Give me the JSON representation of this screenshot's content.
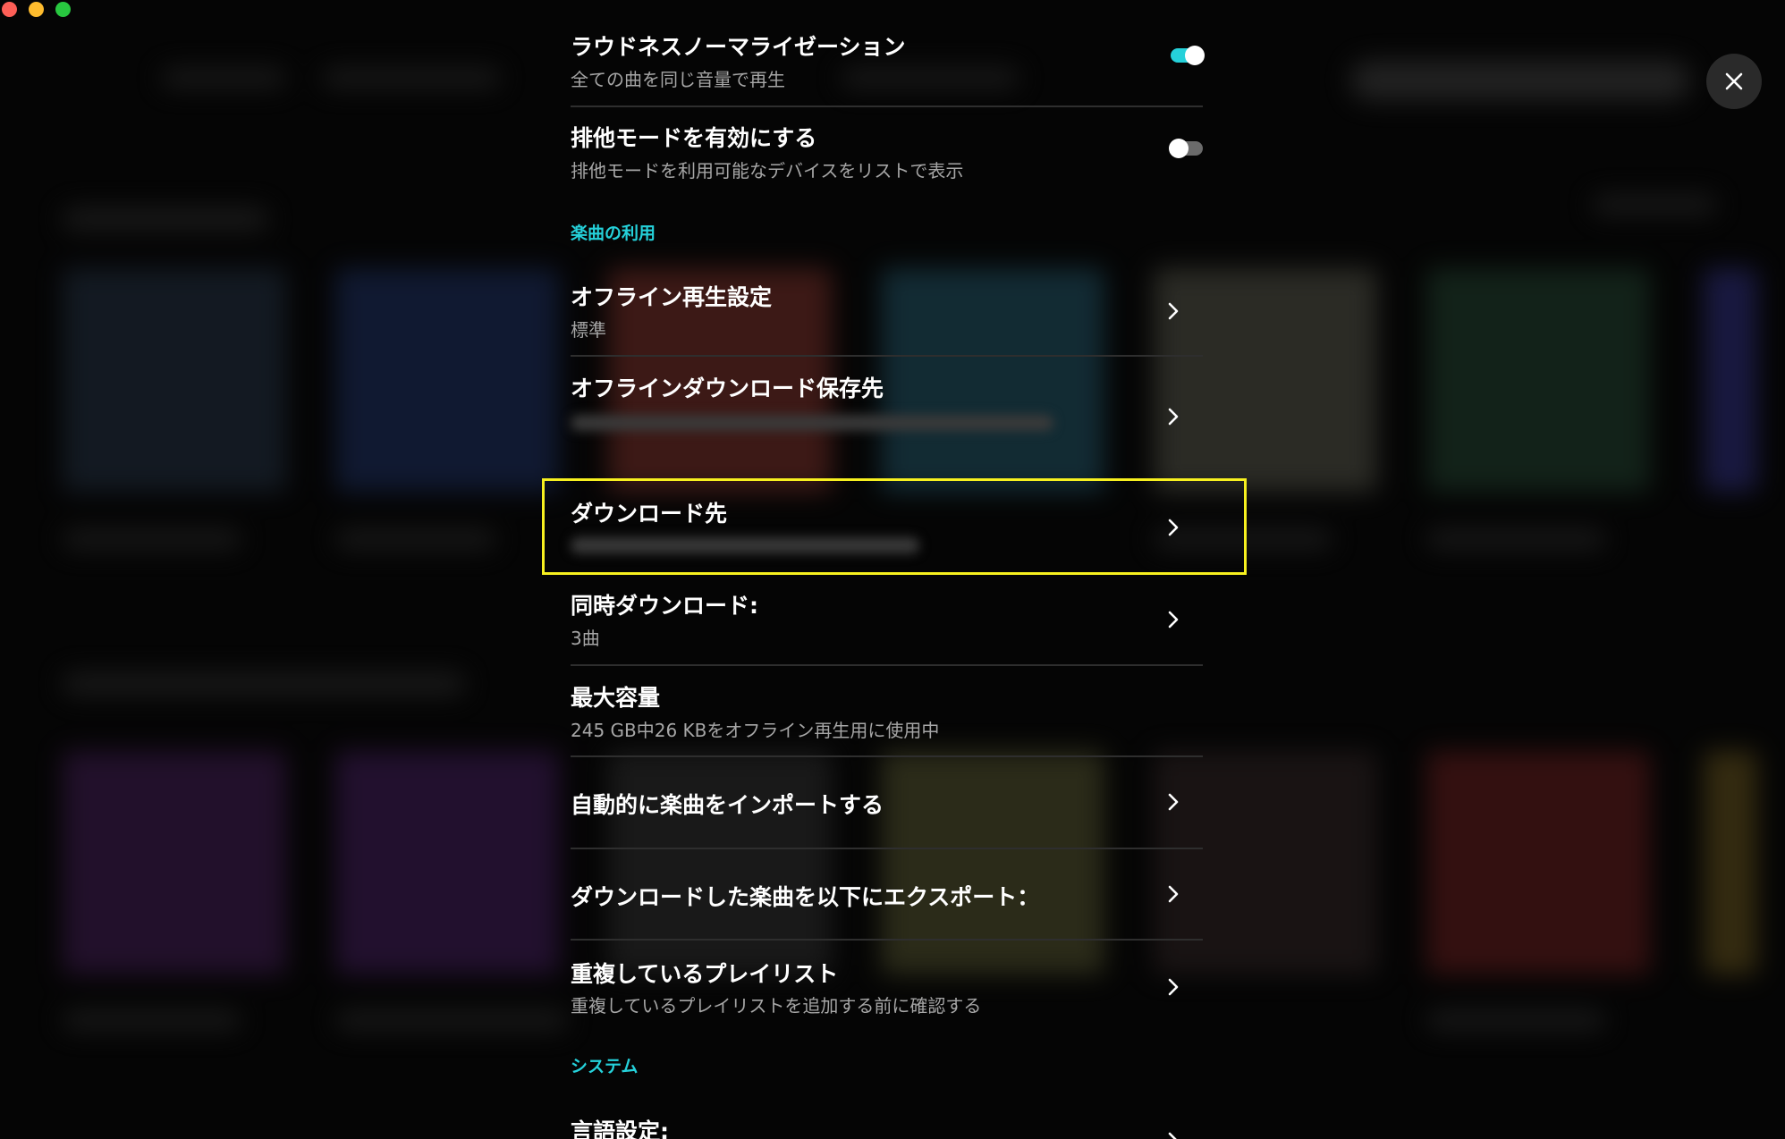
{
  "window": {
    "controls": [
      "close",
      "minimize",
      "zoom"
    ]
  },
  "modal": {
    "close_icon": "close-icon"
  },
  "settings": {
    "loudness": {
      "title": "ラウドネスノーマライゼーション",
      "subtitle": "全ての曲を同じ音量で再生",
      "enabled": true
    },
    "exclusive": {
      "title": "排他モードを有効にする",
      "subtitle": "排他モードを利用可能なデバイスをリストで表示",
      "enabled": false
    },
    "section_music": "楽曲の利用",
    "offline_playback": {
      "title": "オフライン再生設定",
      "subtitle": "標準"
    },
    "offline_download_location": {
      "title": "オフラインダウンロード保存先"
    },
    "download_location": {
      "title": "ダウンロード先"
    },
    "concurrent_downloads": {
      "title": "同時ダウンロード:",
      "subtitle": "3曲"
    },
    "max_capacity": {
      "title": "最大容量",
      "subtitle": "245 GB中26 KBをオフライン再生用に使用中"
    },
    "auto_import": {
      "title": "自動的に楽曲をインポートする"
    },
    "export": {
      "title": "ダウンロードした楽曲を以下にエクスポート："
    },
    "duplicate_playlist": {
      "title": "重複しているプレイリスト",
      "subtitle": "重複しているプレイリストを追加する前に確認する"
    },
    "section_system": "システム",
    "language": {
      "title": "言語設定:"
    }
  },
  "colors": {
    "accent": "#25d1da",
    "highlight": "#f7f01f",
    "background": "#050505"
  }
}
